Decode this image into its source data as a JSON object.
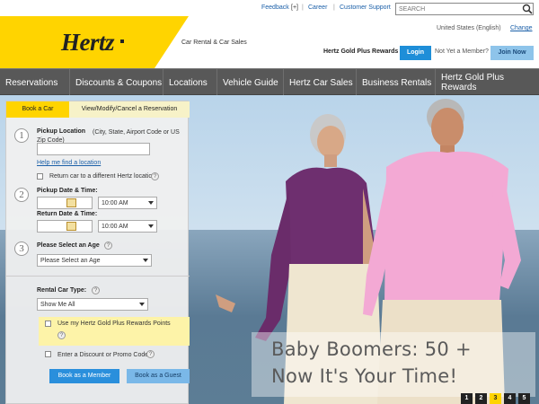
{
  "topbar": {
    "feedback": "Feedback",
    "feedback_icon": "[+]",
    "career": "Career",
    "customer_support": "Customer Support",
    "search_placeholder": "SEARCH"
  },
  "brand": {
    "logo": "Hertz",
    "tagline": "Car Rental & Car Sales",
    "yellow": "#FFD400"
  },
  "account": {
    "locale": "United States  (English)",
    "change": "Change",
    "gold_label": "Hertz Gold Plus Rewards",
    "login": "Login",
    "not_member": "Not Yet a Member?",
    "join": "Join Now"
  },
  "nav": {
    "items": [
      {
        "label": "Reservations"
      },
      {
        "label": "Discounts & Coupons"
      },
      {
        "label": "Locations"
      },
      {
        "label": "Vehicle Guide"
      },
      {
        "label": "Hertz Car Sales"
      },
      {
        "label": "Business Rentals"
      },
      {
        "label": "Hertz Gold Plus Rewards"
      }
    ]
  },
  "booking": {
    "tab_book": "Book a Car",
    "tab_modify": "View/Modify/Cancel a Reservation",
    "step1": "1",
    "step2": "2",
    "step3": "3",
    "pickup_location_label": "Pickup Location",
    "pickup_location_hint": "(City, State, Airport Code or US Zip Code)",
    "help_find": "Help me find a location",
    "return_different": "Return car to a different Hertz location",
    "pickup_datetime": "Pickup Date & Time:",
    "pickup_time": "10:00 AM",
    "return_datetime": "Return Date & Time:",
    "return_time": "10:00 AM",
    "age_label": "Please Select an Age",
    "age_value": "Please Select an Age",
    "car_type_label": "Rental Car Type:",
    "car_type_value": "Show Me All",
    "use_points": "Use my Hertz Gold Plus Rewards Points",
    "discount": "Enter a Discount or Promo Code",
    "book_member": "Book as a Member",
    "book_guest": "Book as a Guest",
    "help_glyph": "?"
  },
  "hero": {
    "line1": "Baby Boomers:  50 +",
    "line2": "Now It's Your Time!",
    "slides": [
      "1",
      "2",
      "3",
      "4",
      "5"
    ],
    "active_slide": 3
  }
}
